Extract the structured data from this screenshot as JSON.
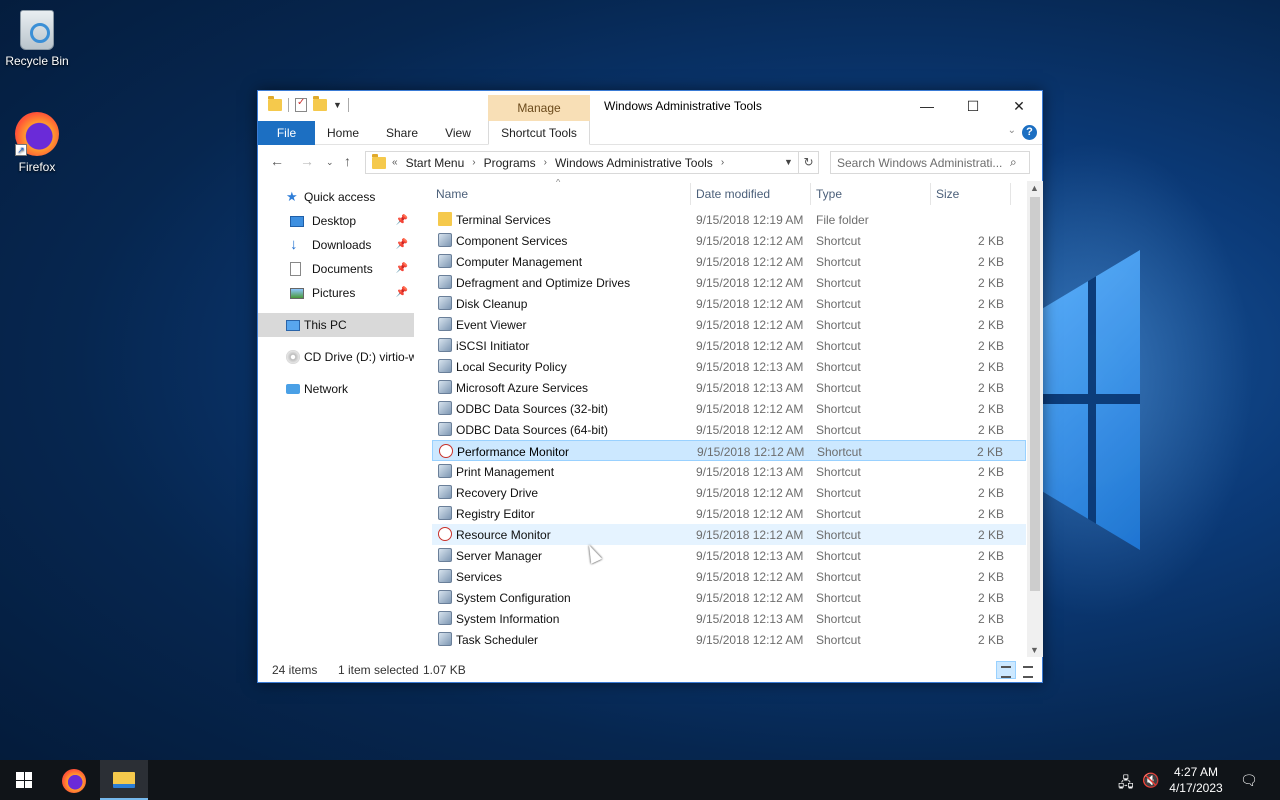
{
  "desktop": {
    "icons": [
      {
        "label": "Recycle Bin"
      },
      {
        "label": "Firefox"
      }
    ]
  },
  "window": {
    "title": "Windows Administrative Tools",
    "contextual_tab_group": "Manage",
    "ribbon_tabs": [
      "File",
      "Home",
      "Share",
      "View",
      "Shortcut Tools"
    ],
    "address": {
      "prefix": "«",
      "crumbs": [
        "Start Menu",
        "Programs",
        "Windows Administrative Tools"
      ]
    },
    "search_placeholder": "Search Windows Administrati..."
  },
  "nav_pane": {
    "quick_access": "Quick access",
    "pinned": [
      "Desktop",
      "Downloads",
      "Documents",
      "Pictures"
    ],
    "this_pc": "This PC",
    "cd_drive": "CD Drive (D:) virtio-w",
    "network": "Network"
  },
  "columns": {
    "name": "Name",
    "date": "Date modified",
    "type": "Type",
    "size": "Size"
  },
  "files": [
    {
      "name": "Terminal Services",
      "date": "9/15/2018 12:19 AM",
      "type": "File folder",
      "size": ""
    },
    {
      "name": "Component Services",
      "date": "9/15/2018 12:12 AM",
      "type": "Shortcut",
      "size": "2 KB"
    },
    {
      "name": "Computer Management",
      "date": "9/15/2018 12:12 AM",
      "type": "Shortcut",
      "size": "2 KB"
    },
    {
      "name": "Defragment and Optimize Drives",
      "date": "9/15/2018 12:12 AM",
      "type": "Shortcut",
      "size": "2 KB"
    },
    {
      "name": "Disk Cleanup",
      "date": "9/15/2018 12:12 AM",
      "type": "Shortcut",
      "size": "2 KB"
    },
    {
      "name": "Event Viewer",
      "date": "9/15/2018 12:12 AM",
      "type": "Shortcut",
      "size": "2 KB"
    },
    {
      "name": "iSCSI Initiator",
      "date": "9/15/2018 12:12 AM",
      "type": "Shortcut",
      "size": "2 KB"
    },
    {
      "name": "Local Security Policy",
      "date": "9/15/2018 12:13 AM",
      "type": "Shortcut",
      "size": "2 KB"
    },
    {
      "name": "Microsoft Azure Services",
      "date": "9/15/2018 12:13 AM",
      "type": "Shortcut",
      "size": "2 KB"
    },
    {
      "name": "ODBC Data Sources (32-bit)",
      "date": "9/15/2018 12:12 AM",
      "type": "Shortcut",
      "size": "2 KB"
    },
    {
      "name": "ODBC Data Sources (64-bit)",
      "date": "9/15/2018 12:12 AM",
      "type": "Shortcut",
      "size": "2 KB"
    },
    {
      "name": "Performance Monitor",
      "date": "9/15/2018 12:12 AM",
      "type": "Shortcut",
      "size": "2 KB"
    },
    {
      "name": "Print Management",
      "date": "9/15/2018 12:13 AM",
      "type": "Shortcut",
      "size": "2 KB"
    },
    {
      "name": "Recovery Drive",
      "date": "9/15/2018 12:12 AM",
      "type": "Shortcut",
      "size": "2 KB"
    },
    {
      "name": "Registry Editor",
      "date": "9/15/2018 12:12 AM",
      "type": "Shortcut",
      "size": "2 KB"
    },
    {
      "name": "Resource Monitor",
      "date": "9/15/2018 12:12 AM",
      "type": "Shortcut",
      "size": "2 KB"
    },
    {
      "name": "Server Manager",
      "date": "9/15/2018 12:13 AM",
      "type": "Shortcut",
      "size": "2 KB"
    },
    {
      "name": "Services",
      "date": "9/15/2018 12:12 AM",
      "type": "Shortcut",
      "size": "2 KB"
    },
    {
      "name": "System Configuration",
      "date": "9/15/2018 12:12 AM",
      "type": "Shortcut",
      "size": "2 KB"
    },
    {
      "name": "System Information",
      "date": "9/15/2018 12:13 AM",
      "type": "Shortcut",
      "size": "2 KB"
    },
    {
      "name": "Task Scheduler",
      "date": "9/15/2018 12:12 AM",
      "type": "Shortcut",
      "size": "2 KB"
    }
  ],
  "selected_file": "Performance Monitor",
  "hovered_file": "Resource Monitor",
  "status": {
    "count": "24 items",
    "selection": "1 item selected",
    "size": "1.07 KB"
  },
  "taskbar": {
    "time": "4:27 AM",
    "date": "4/17/2023"
  },
  "colors": {
    "accent": "#1c6fc2",
    "selection": "#cce8ff",
    "manage_tab": "#f8dfb6",
    "taskbar": "#101418"
  }
}
